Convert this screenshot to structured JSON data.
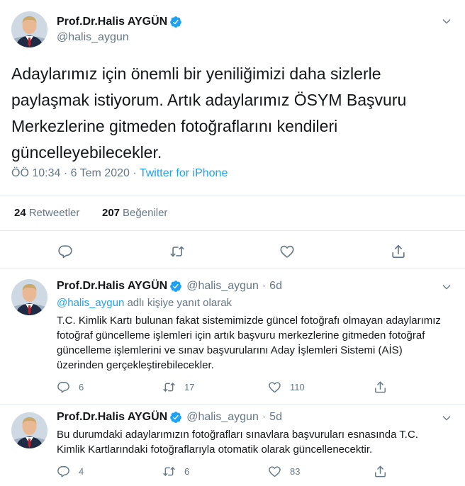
{
  "main_tweet": {
    "author_name": "Prof.Dr.Halis AYGÜN",
    "author_handle": "@halis_aygun",
    "text": "Adaylarımız için önemli bir yeniliğimizi  daha sizlerle paylaşmak istiyorum. Artık adaylarımız ÖSYM Başvuru Merkezlerine gitmeden fotoğraflarını kendileri güncelleyebilecekler.",
    "timestamp": "ÖÖ 10:34 · 6 Tem 2020 · ",
    "source": "Twitter for iPhone",
    "retweet_count": "24",
    "retweet_label": "Retweetler",
    "like_count": "207",
    "like_label": "Beğeniler"
  },
  "replies": [
    {
      "author_name": "Prof.Dr.Halis AYGÜN",
      "author_handle": "@halis_aygun",
      "separator": "·",
      "time_ago": "6d",
      "replying_to_handle": "@halis_aygun",
      "replying_to_suffix": " adlı kişiye yanıt olarak",
      "text": "T.C. Kimlik Kartı bulunan fakat sistemimizde güncel fotoğrafı olmayan adaylarımız fotoğraf güncelleme işlemleri için artık başvuru merkezlerine gitmeden fotoğraf güncelleme işlemlerini ve sınav başvurularını Aday İşlemleri Sistemi (AİS) üzerinden gerçekleştirebilecekler.",
      "reply_count": "6",
      "retweet_count": "17",
      "like_count": "110"
    },
    {
      "author_name": "Prof.Dr.Halis AYGÜN",
      "author_handle": "@halis_aygun",
      "separator": "·",
      "time_ago": "5d",
      "text": "Bu durumdaki adaylarımızın fotoğrafları sınavlara başvuruları esnasında T.C. Kimlik Kartlarındaki fotoğraflarıyla otomatik olarak güncellenecektir.",
      "reply_count": "4",
      "retweet_count": "6",
      "like_count": "83"
    }
  ],
  "colors": {
    "accent": "#1da1f2",
    "secondary_text": "#657786",
    "divider": "#e6ecf0"
  },
  "icons": [
    "verified-badge-icon",
    "chevron-down-icon",
    "reply-icon",
    "retweet-icon",
    "like-icon",
    "share-icon"
  ]
}
